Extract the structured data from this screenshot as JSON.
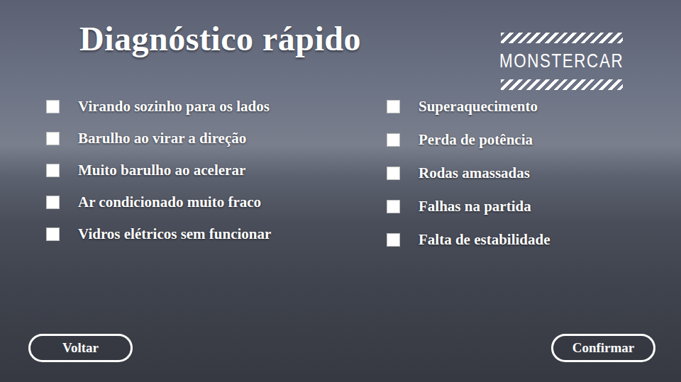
{
  "title": "Diagnóstico rápido",
  "logo": "MONSTERCAR",
  "checklist_left": [
    {
      "label": "Virando sozinho para os lados",
      "checked": false
    },
    {
      "label": "Barulho ao virar a direção",
      "checked": false
    },
    {
      "label": "Muito barulho ao acelerar",
      "checked": false
    },
    {
      "label": "Ar condicionado muito fraco",
      "checked": false
    },
    {
      "label": "Vidros elétricos sem funcionar",
      "checked": false
    }
  ],
  "checklist_right": [
    {
      "label": "Superaquecimento",
      "checked": false
    },
    {
      "label": "Perda de potência",
      "checked": false
    },
    {
      "label": "Rodas amassadas",
      "checked": false
    },
    {
      "label": "Falhas na partida",
      "checked": false
    },
    {
      "label": "Falta de estabilidade",
      "checked": false
    }
  ],
  "buttons": [
    "Voltar",
    "Confirmar"
  ]
}
